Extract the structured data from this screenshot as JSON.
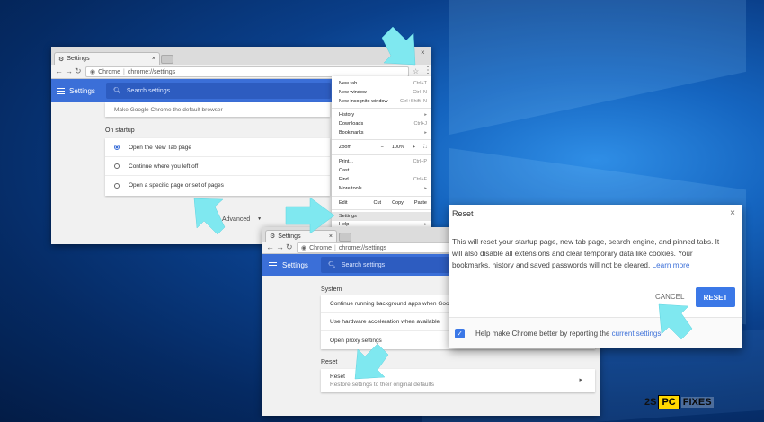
{
  "win1": {
    "tab_title": "Settings",
    "url_origin": "Chrome",
    "url_path": "chrome://settings",
    "header_title": "Settings",
    "search_placeholder": "Search settings",
    "default_browser_text": "Make Google Chrome the default browser",
    "on_startup_label": "On startup",
    "startup_options": [
      "Open the New Tab page",
      "Continue where you left off",
      "Open a specific page or set of pages"
    ],
    "advanced_label": "Advanced"
  },
  "menu": {
    "new_tab": "New tab",
    "new_tab_sc": "Ctrl+T",
    "new_window": "New window",
    "new_window_sc": "Ctrl+N",
    "incognito": "New incognito window",
    "incognito_sc": "Ctrl+Shift+N",
    "history": "History",
    "downloads": "Downloads",
    "downloads_sc": "Ctrl+J",
    "bookmarks": "Bookmarks",
    "zoom": "Zoom",
    "zoom_minus": "−",
    "zoom_value": "100%",
    "zoom_plus": "+",
    "print": "Print...",
    "print_sc": "Ctrl+P",
    "cast": "Cast...",
    "find": "Find...",
    "find_sc": "Ctrl+F",
    "more_tools": "More tools",
    "edit": "Edit",
    "cut": "Cut",
    "copy": "Copy",
    "paste": "Paste",
    "settings": "Settings",
    "help": "Help"
  },
  "win2": {
    "tab_title": "Settings",
    "url_origin": "Chrome",
    "url_path": "chrome://settings",
    "header_title": "Settings",
    "search_placeholder": "Search settings",
    "system_label": "System",
    "system_rows": [
      "Continue running background apps when Google Ch",
      "Use hardware acceleration when available",
      "Open proxy settings"
    ],
    "reset_label": "Reset",
    "reset_row_title": "Reset",
    "reset_row_sub": "Restore settings to their original defaults"
  },
  "dialog": {
    "title": "Reset",
    "body": "This will reset your startup page, new tab page, search engine, and pinned tabs. It will also disable all extensions and clear temporary data like cookies. Your bookmarks, history and saved passwords will not be cleared.",
    "learn_more": "Learn more",
    "cancel": "CANCEL",
    "reset": "RESET",
    "footer_text": "Help make Chrome better by reporting the",
    "footer_link": "current settings"
  },
  "logo": {
    "left": "2S",
    "pc": "PC",
    "right": "FIXES"
  },
  "colors": {
    "accent": "#3b6fd8",
    "arrow": "#7fe8f0",
    "desktop": "#0a3f8a"
  }
}
